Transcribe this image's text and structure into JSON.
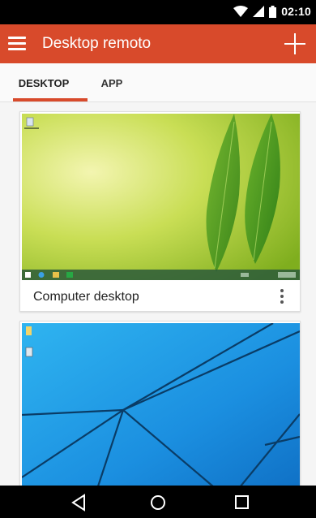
{
  "status_bar": {
    "time": "02:10",
    "icons": [
      "wifi-icon",
      "signal-icon",
      "battery-icon"
    ]
  },
  "app_bar": {
    "title": "Desktop remoto",
    "menu_icon": "menu-icon",
    "add_icon": "add-icon",
    "color": "#d84a2b"
  },
  "tabs": [
    {
      "label": "DESKTOP",
      "selected": true
    },
    {
      "label": "APP",
      "selected": false
    }
  ],
  "desktops": [
    {
      "label": "Computer desktop",
      "thumbnail": "Windows 8.1 green leaf wallpaper"
    },
    {
      "label": "",
      "thumbnail": "Windows 10 blue wallpaper"
    }
  ],
  "nav_bar": {
    "icons": [
      "back-icon",
      "home-icon",
      "recents-icon"
    ]
  }
}
